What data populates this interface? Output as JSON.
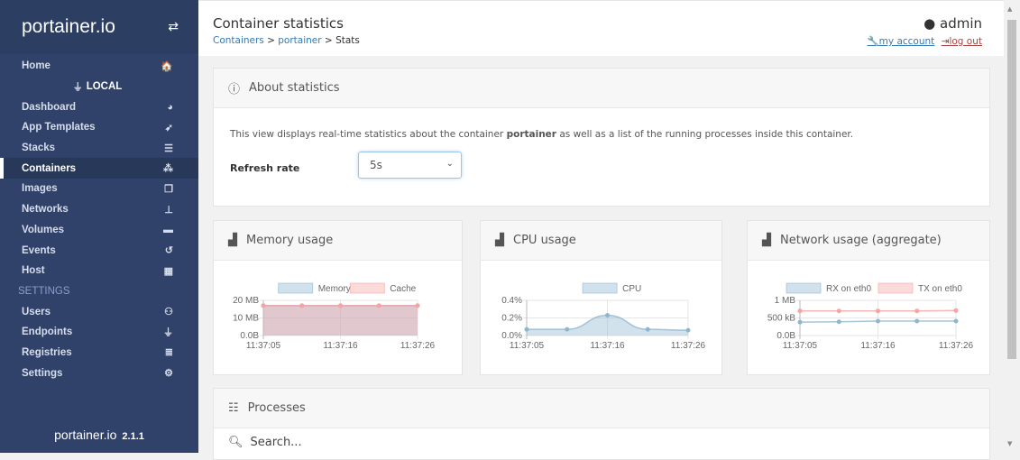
{
  "sidebar": {
    "brand": "portainer.io",
    "items": [
      {
        "label": "Home",
        "icon": "home-icon",
        "glyph": "🏠"
      },
      {
        "label": "LOCAL",
        "icon": "plug-icon",
        "glyph": "⏚",
        "type": "endpoint"
      },
      {
        "label": "Dashboard",
        "icon": "tachometer-icon",
        "glyph": "◕"
      },
      {
        "label": "App Templates",
        "icon": "rocket-icon",
        "glyph": "➶"
      },
      {
        "label": "Stacks",
        "icon": "th-list-icon",
        "glyph": "☰"
      },
      {
        "label": "Containers",
        "icon": "cubes-icon",
        "glyph": "⁂",
        "active": true
      },
      {
        "label": "Images",
        "icon": "clone-icon",
        "glyph": "❐"
      },
      {
        "label": "Networks",
        "icon": "sitemap-icon",
        "glyph": "⊥"
      },
      {
        "label": "Volumes",
        "icon": "hdd-icon",
        "glyph": "▬"
      },
      {
        "label": "Events",
        "icon": "history-icon",
        "glyph": "↺"
      },
      {
        "label": "Host",
        "icon": "th-icon",
        "glyph": "▦"
      },
      {
        "label": "SETTINGS",
        "type": "section"
      },
      {
        "label": "Users",
        "icon": "users-icon",
        "glyph": "⚇"
      },
      {
        "label": "Endpoints",
        "icon": "plug-icon",
        "glyph": "⏚"
      },
      {
        "label": "Registries",
        "icon": "database-icon",
        "glyph": "≣"
      },
      {
        "label": "Settings",
        "icon": "cogs-icon",
        "glyph": "⚙"
      }
    ],
    "footer_brand": "portainer.io",
    "version": "2.1.1"
  },
  "header": {
    "title": "Container statistics",
    "crumbs": [
      "Containers",
      "portainer",
      "Stats"
    ],
    "user": "admin",
    "my_account": "my account",
    "log_out": "log out"
  },
  "about": {
    "title": "About statistics",
    "desc_pre": "This view displays real-time statistics about the container ",
    "desc_bold": "portainer",
    "desc_post": " as well as a list of the running processes inside this container.",
    "refresh_label": "Refresh rate",
    "refresh_value": "5s"
  },
  "panels": {
    "memory": "Memory usage",
    "cpu": "CPU usage",
    "network": "Network usage (aggregate)",
    "processes": "Processes",
    "search_placeholder": "Search..."
  },
  "colors": {
    "sidebar": "#30426a",
    "blue_series": "#8fb6cf",
    "red_series": "#f5a3a3",
    "link": "#337ab7",
    "logout": "#a94442"
  },
  "chart_data": [
    {
      "type": "line",
      "title": "",
      "x": [
        "11:37:05",
        "",
        "11:37:16",
        "",
        "11:37:26"
      ],
      "xticks": [
        "11:37:05",
        "11:37:16",
        "11:37:26"
      ],
      "yticks": [
        "0.0B",
        "10 MB",
        "20 MB"
      ],
      "ylim": [
        0,
        20
      ],
      "series": [
        {
          "name": "Memory",
          "values": [
            17,
            17,
            17,
            17,
            17
          ],
          "color": "#8fb6cf"
        },
        {
          "name": "Cache",
          "values": [
            17,
            17,
            17,
            17,
            17
          ],
          "color": "#f5a3a3"
        }
      ],
      "fill": true
    },
    {
      "type": "line",
      "title": "",
      "x": [
        "11:37:05",
        "",
        "11:37:16",
        "",
        "11:37:26"
      ],
      "xticks": [
        "11:37:05",
        "11:37:16",
        "11:37:26"
      ],
      "yticks": [
        "0.0%",
        "0.2%",
        "0.4%"
      ],
      "ylim": [
        0,
        0.4
      ],
      "series": [
        {
          "name": "CPU",
          "values": [
            0.07,
            0.07,
            0.23,
            0.07,
            0.06
          ],
          "color": "#8fb6cf"
        }
      ],
      "fill": true,
      "smooth": true
    },
    {
      "type": "line",
      "title": "",
      "x": [
        "11:37:05",
        "",
        "11:37:16",
        "",
        "11:37:26"
      ],
      "xticks": [
        "11:37:05",
        "11:37:16",
        "11:37:26"
      ],
      "yticks": [
        "0.0B",
        "500 kB",
        "1 MB"
      ],
      "ylim": [
        0,
        1000
      ],
      "series": [
        {
          "name": "RX on eth0",
          "values": [
            380,
            390,
            410,
            410,
            410
          ],
          "color": "#8fb6cf"
        },
        {
          "name": "TX on eth0",
          "values": [
            700,
            700,
            700,
            700,
            710
          ],
          "color": "#f5a3a3"
        }
      ],
      "fill": false
    }
  ]
}
